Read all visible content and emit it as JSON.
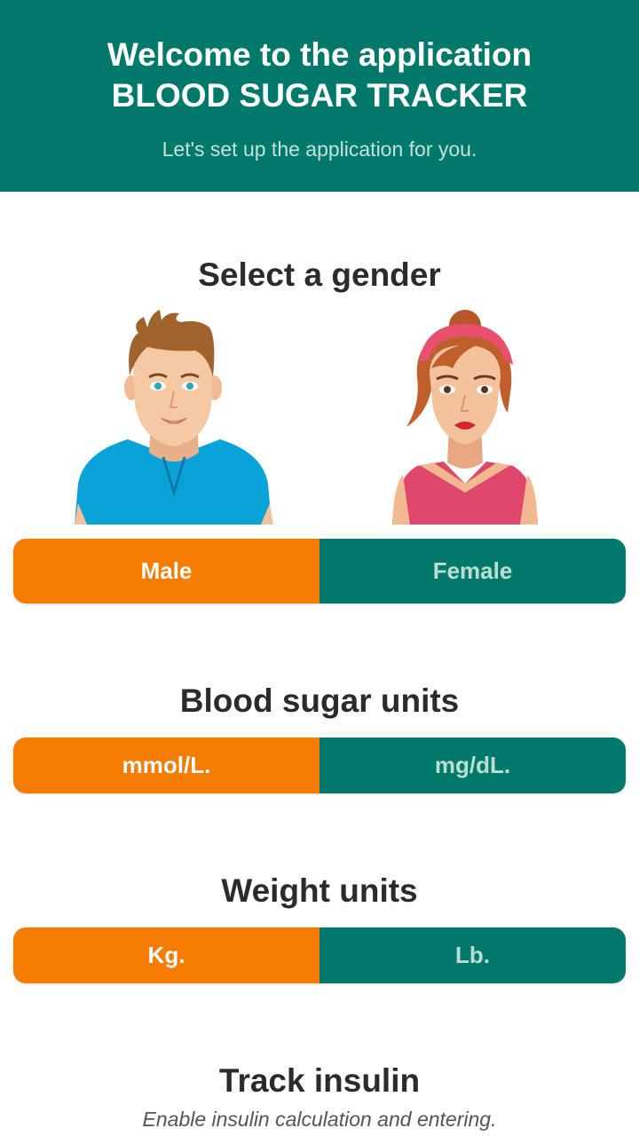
{
  "header": {
    "title_line1": "Welcome to the application",
    "title_line2": "BLOOD SUGAR TRACKER",
    "subtitle": "Let's set up the application for you."
  },
  "gender": {
    "title": "Select a gender",
    "options": [
      "Male",
      "Female"
    ],
    "selected": "Male"
  },
  "sugar_units": {
    "title": "Blood sugar units",
    "options": [
      "mmol/L.",
      "mg/dL."
    ],
    "selected": "mmol/L."
  },
  "weight_units": {
    "title": "Weight units",
    "options": [
      "Kg.",
      "Lb."
    ],
    "selected": "Kg."
  },
  "insulin": {
    "title": "Track insulin",
    "subtitle": "Enable insulin calculation and entering."
  },
  "colors": {
    "primary": "#00796b",
    "accent": "#f57c00"
  }
}
